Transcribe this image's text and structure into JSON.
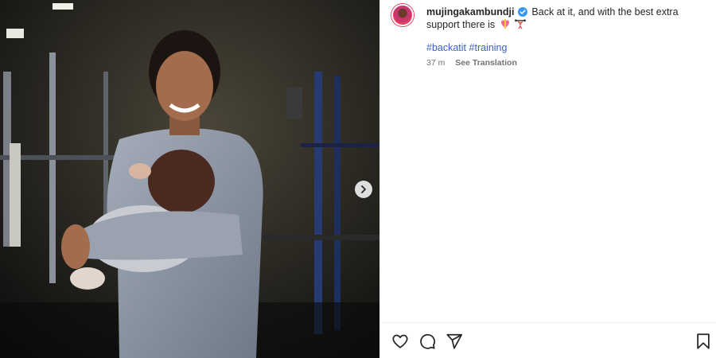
{
  "post": {
    "username": "mujingakambundji",
    "caption": "Back at it, and with the best extra support there is",
    "hashtags": [
      "#backatit",
      "#training"
    ],
    "timestamp": "37 m",
    "see_translation": "See Translation"
  },
  "icons": {
    "verified": "verified-badge-icon",
    "emoji_1": "heart-ribbon-emoji-icon",
    "emoji_2": "weightlifter-emoji-icon",
    "next": "chevron-right-icon",
    "like": "heart-outline-icon",
    "comment": "comment-bubble-icon",
    "share": "paper-plane-icon",
    "save": "bookmark-icon"
  },
  "colors": {
    "hashtag": "#3a5fc5",
    "verified": "#3797f0",
    "muted_text": "#737373"
  }
}
